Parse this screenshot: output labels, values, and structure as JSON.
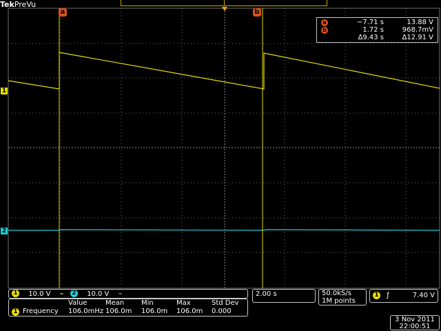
{
  "brand": {
    "prefix": "Tek",
    "label": "PreVu"
  },
  "colors": {
    "ch1": "#e8e000",
    "ch2": "#19d1d8",
    "cursor": "#d9521a",
    "grid": "#707070",
    "panel_border": "#c9c9c9"
  },
  "cursors": {
    "a_label": "a",
    "b_label": "b"
  },
  "readout": {
    "a": {
      "time": "−7.71 s",
      "value": "13.88 V"
    },
    "b": {
      "time": "1.72 s",
      "value": "968.7mV"
    },
    "delta": {
      "time": "∆9.43 s",
      "value": "∆12.91 V"
    }
  },
  "channels": {
    "ch1": {
      "marker": "1",
      "scale": "10.0 V",
      "coupling_icon": "bandwidth-limit-icon"
    },
    "ch2": {
      "marker": "2",
      "scale": "10.0 V",
      "coupling_icon": "bandwidth-limit-icon"
    }
  },
  "timebase": "2.00 s",
  "acquisition": {
    "rate": "50.0kS/s",
    "record": "1M points"
  },
  "trigger": {
    "channel": "1",
    "slope_icon": "rising-edge-icon",
    "level": "7.40 V"
  },
  "measurements": {
    "headers": [
      "Value",
      "Mean",
      "Min",
      "Max",
      "Std Dev"
    ],
    "row": {
      "channel": "1",
      "name": "Frequency",
      "value": "106.0mHz",
      "mean": "106.0m",
      "min": "106.0m",
      "max": "106.0m",
      "std_dev": "0.000"
    }
  },
  "datetime": {
    "date": "3 Nov 2011",
    "time": "22:00:51"
  }
}
